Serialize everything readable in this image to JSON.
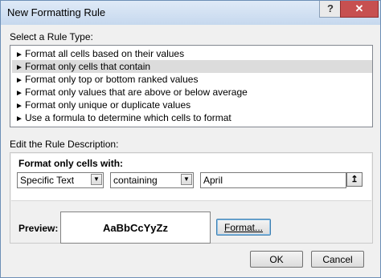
{
  "window": {
    "title": "New Formatting Rule",
    "help_label": "?",
    "close_label": "✕"
  },
  "rule_type": {
    "label": "Select a Rule Type:",
    "items": [
      {
        "label": "Format all cells based on their values",
        "selected": false
      },
      {
        "label": "Format only cells that contain",
        "selected": true
      },
      {
        "label": "Format only top or bottom ranked values",
        "selected": false
      },
      {
        "label": "Format only values that are above or below average",
        "selected": false
      },
      {
        "label": "Format only unique or duplicate values",
        "selected": false
      },
      {
        "label": "Use a formula to determine which cells to format",
        "selected": false
      }
    ],
    "item_arrow": "►"
  },
  "description": {
    "label": "Edit the Rule Description:",
    "format_only_label": "Format only cells with:",
    "condition_select": {
      "value": "Specific Text"
    },
    "operator_select": {
      "value": "containing"
    },
    "text_value": "April",
    "ref_button_icon": "↥"
  },
  "preview": {
    "label": "Preview:",
    "sample": "AaBbCcYyZz"
  },
  "buttons": {
    "format": "Format...",
    "ok": "OK",
    "cancel": "Cancel"
  }
}
